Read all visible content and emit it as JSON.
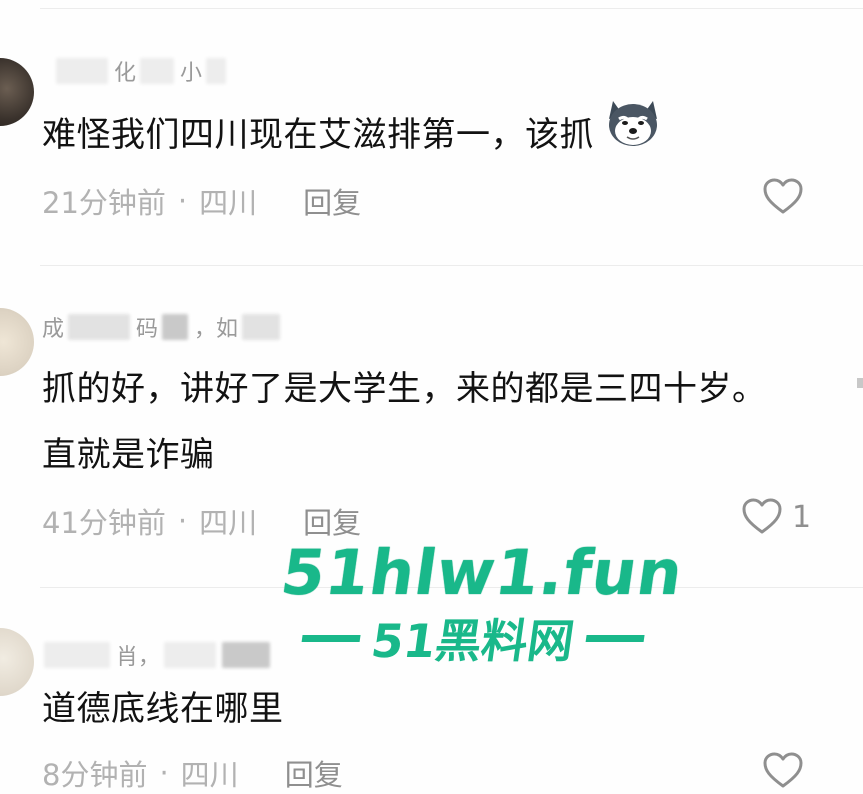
{
  "comments": [
    {
      "username_visible": "化",
      "username_tail": "小",
      "text": "难怪我们四川现在艾滋排第一，该抓",
      "emoji": "husky-dog-emoji",
      "time": "21分钟前",
      "separator": "·",
      "location": "四川",
      "reply": "回复",
      "likes": ""
    },
    {
      "username_visible": "成",
      "username_mid": "码",
      "username_tail": "，如",
      "text_line1": "抓的好，讲好了是大学生，来的都是三四十岁。",
      "text_line2": "直就是诈骗",
      "time": "41分钟前",
      "separator": "·",
      "location": "四川",
      "reply": "回复",
      "likes": "1"
    },
    {
      "username_visible": "肖，",
      "text": "道德底线在哪里",
      "time": "8分钟前",
      "separator": "·",
      "location": "四川",
      "reply": "回复",
      "likes": ""
    }
  ],
  "watermark": {
    "url": "51hlw1.fun",
    "subtitle": "51黑料网"
  },
  "icons": {
    "like": "heart-outline-icon"
  },
  "colors": {
    "watermark": "#19b88a",
    "meta_text": "#b2b2b2"
  }
}
